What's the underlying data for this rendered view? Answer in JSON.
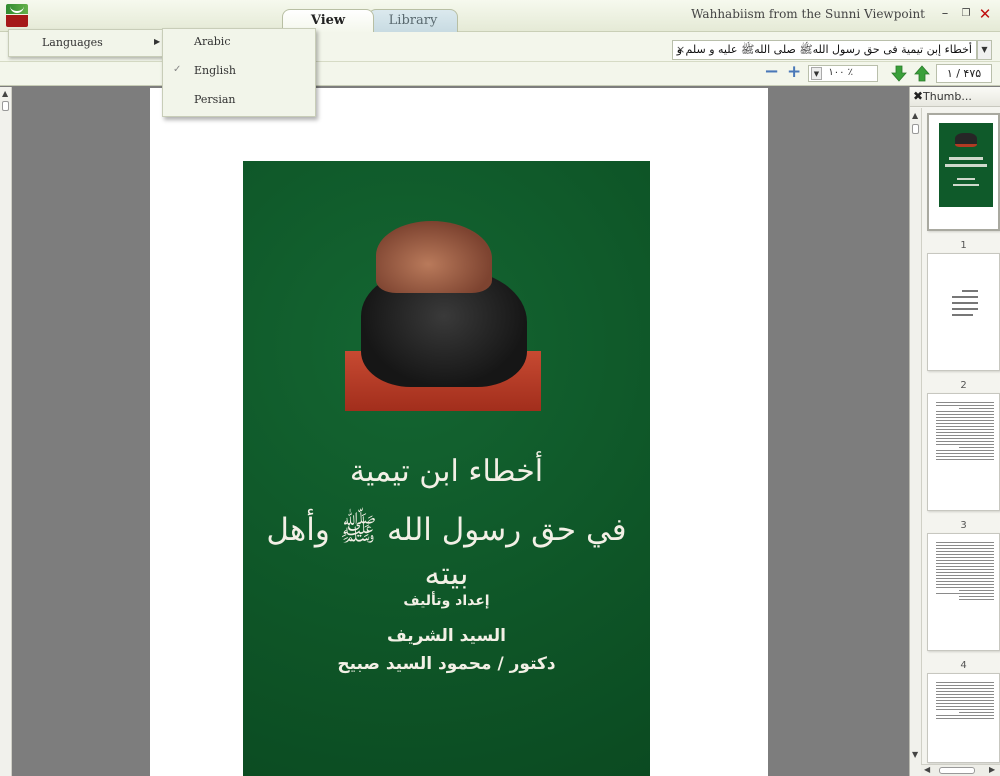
{
  "window": {
    "title": "Wahhabiism from the Sunni Viewpoint",
    "tabs": [
      {
        "label": "View",
        "active": true
      },
      {
        "label": "Library",
        "active": false
      }
    ],
    "min_glyph": "–",
    "restore_glyph": "❐",
    "close_glyph": "✕"
  },
  "toolbar": {
    "book_title": "أخطاء إبن تيمية فى حق رسول اللهﷺ صلى اللهﷺ عليه و سلم و أهل بيته",
    "title_close": "×",
    "dropdown_glyph": "▼",
    "zoom_value": "۱۰۰ ٪",
    "zoom_arrow": "▼",
    "zoom_minus": "−",
    "zoom_plus": "+",
    "page_indicator": "۱ / ۴۷۵"
  },
  "menu": {
    "languages_label": "Languages",
    "arrow": "▶",
    "items": [
      {
        "label": "Arabic",
        "checked": false
      },
      {
        "label": "English",
        "checked": true
      },
      {
        "label": "Persian",
        "checked": false
      }
    ],
    "check_glyph": "✓"
  },
  "cover": {
    "title_line1": "أخطاء ابن تيمية",
    "title_line2": "في حق رسول الله ﷺ وأهل بيته",
    "prepared_by": "إعداد وتأليف",
    "author_line1": "السيد الشريف",
    "author_line2": "دكتور / محمود السيد صبيح"
  },
  "thumbnails": {
    "header_label": "Thumb...",
    "close_glyph": "✖",
    "page_numbers": [
      "1",
      "2",
      "3",
      "4"
    ]
  },
  "scroll": {
    "up": "▲",
    "down": "▼",
    "left": "◀",
    "right": "▶"
  },
  "colors": {
    "cover_green": "#0f5a2a",
    "close_red": "#c01010",
    "nav_green": "#3aa03a"
  }
}
